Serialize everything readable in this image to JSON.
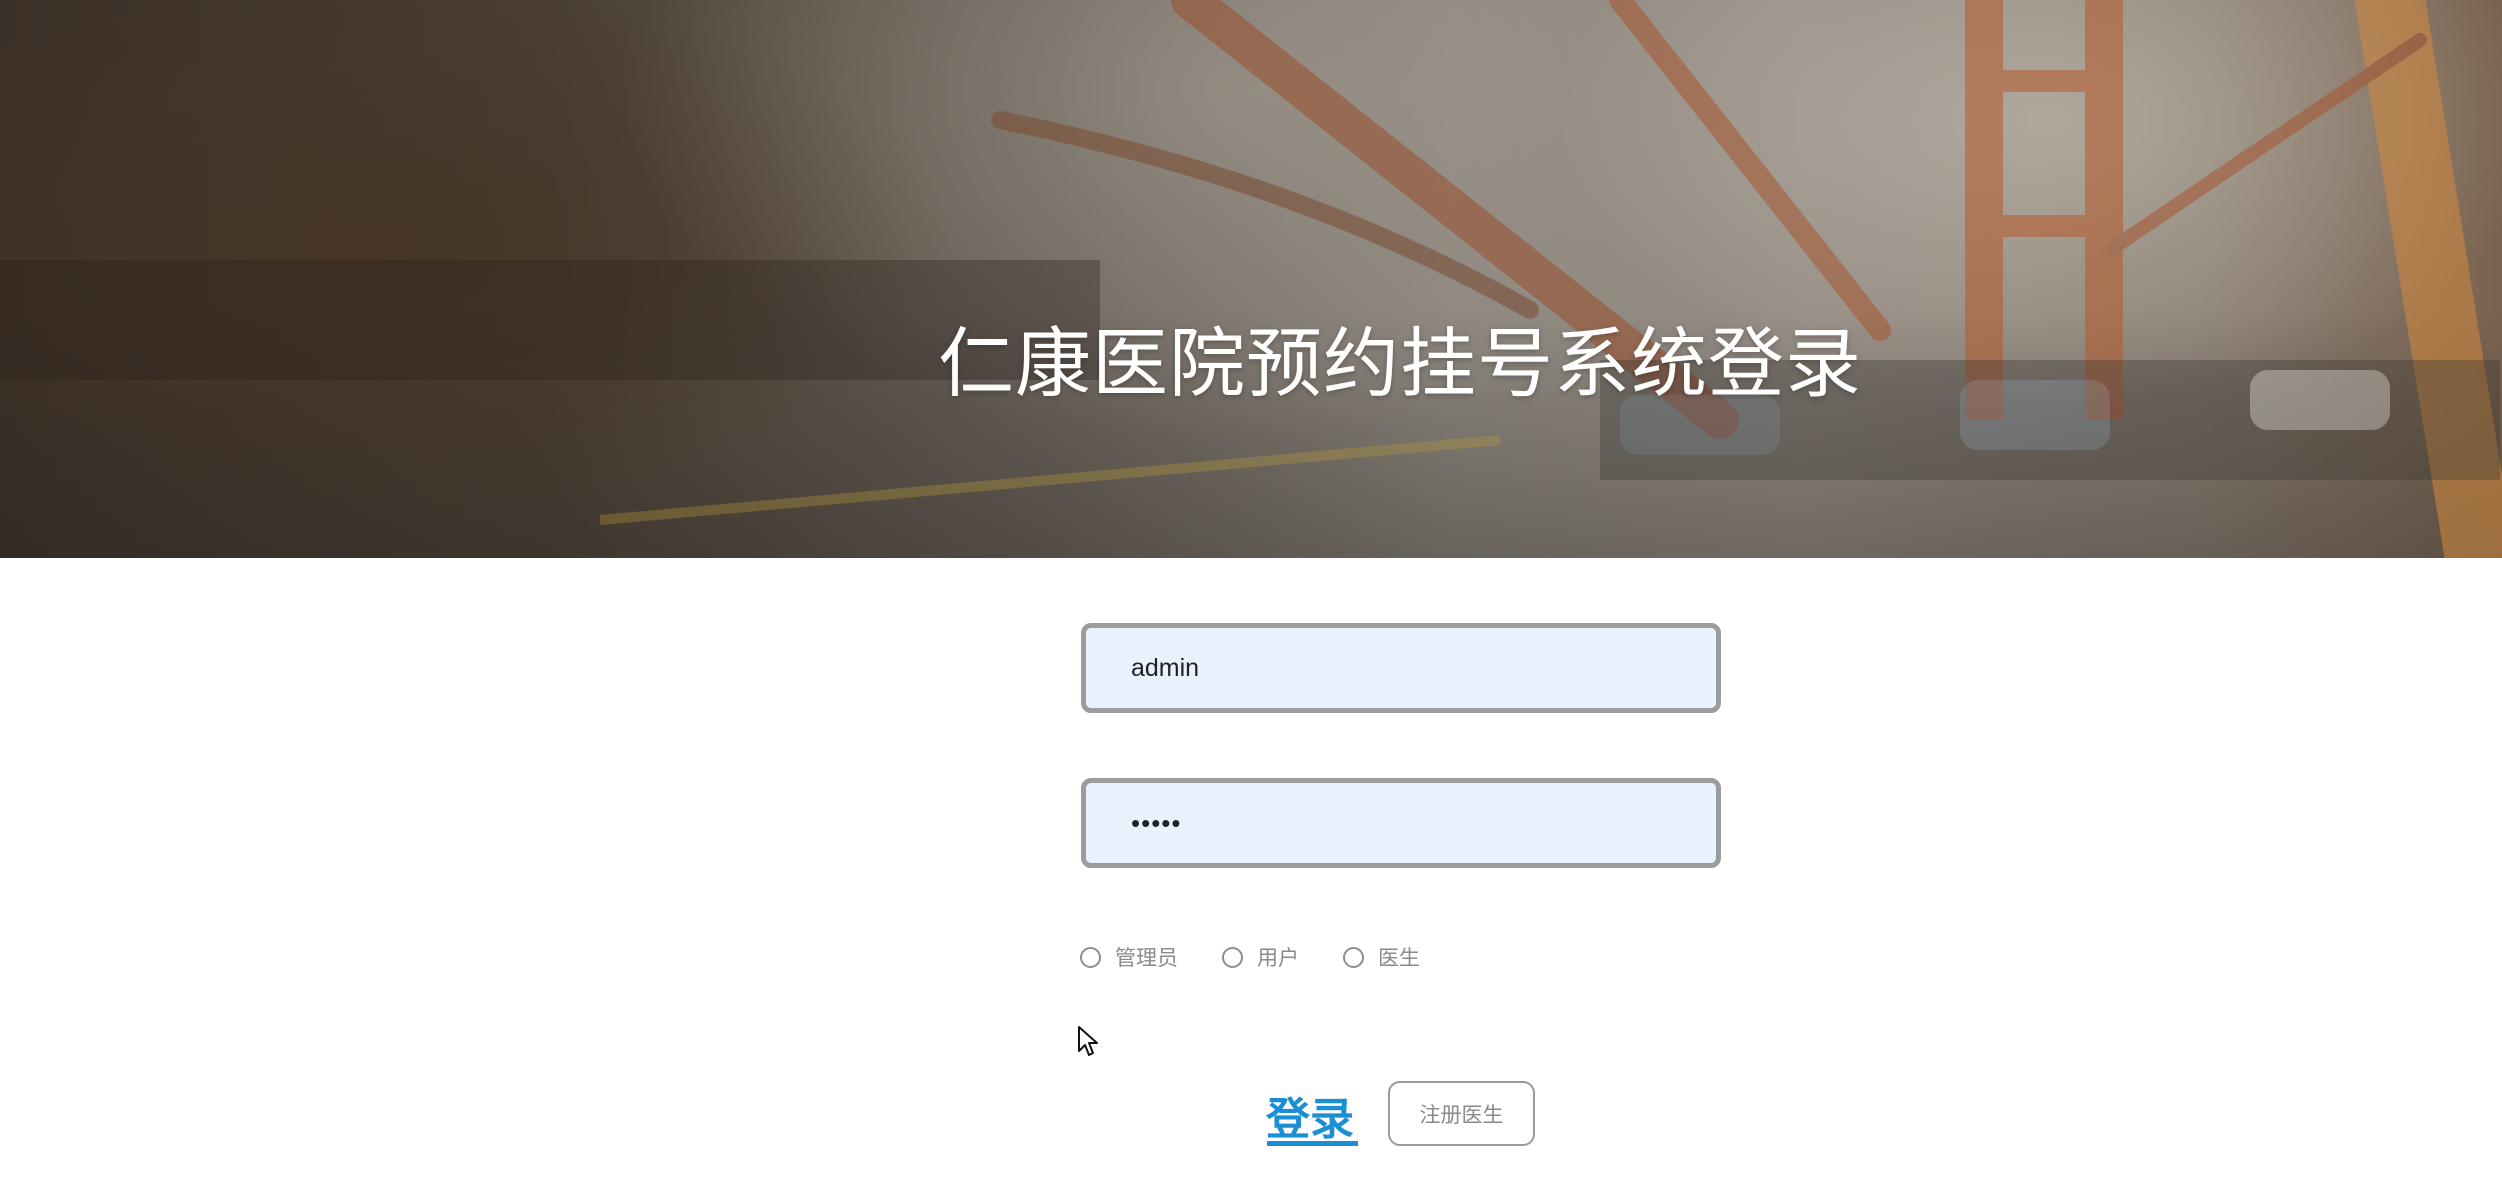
{
  "page": {
    "title": "仁康医院预约挂号系统登录"
  },
  "form": {
    "username_value": "admin",
    "password_value": "•••••",
    "roles": [
      {
        "label": "管理员",
        "selected": false
      },
      {
        "label": "用户",
        "selected": false
      },
      {
        "label": "医生",
        "selected": false
      }
    ],
    "login_label": "登录",
    "register_label": "注册医生"
  },
  "colors": {
    "accent": "#1a8fd6",
    "input_bg": "#e8f2fd",
    "input_border": "#9c9c9c",
    "muted_text": "#8a8a8a"
  },
  "icons": {
    "cursor": "mouse-pointer-icon"
  }
}
